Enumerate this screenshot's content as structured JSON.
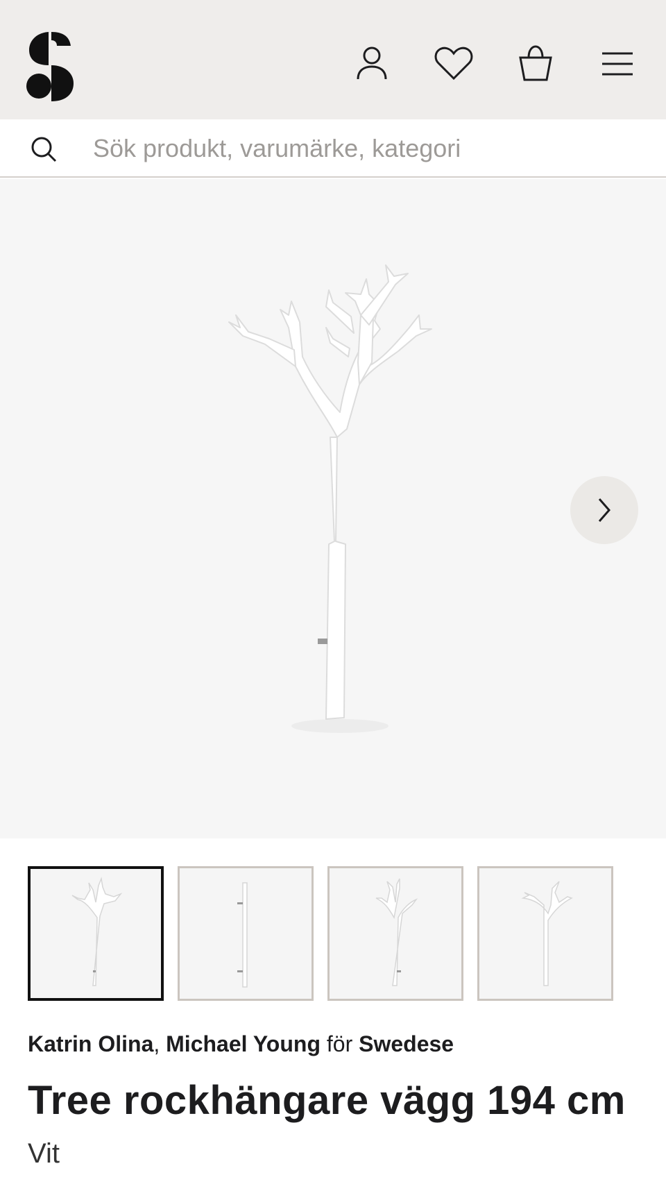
{
  "header": {
    "logo_alt": "S",
    "icons": [
      "account-icon",
      "heart-icon",
      "basket-icon",
      "menu-icon"
    ]
  },
  "search": {
    "placeholder": "Sök produkt, varumärke, kategori"
  },
  "gallery": {
    "thumbnail_count": 4,
    "active_index": 0
  },
  "product": {
    "designer_1": "Katrin Olina",
    "separator": ",",
    "designer_2": "Michael Young",
    "for_word": "för",
    "brand": "Swedese",
    "title": "Tree rockhängare vägg 194 cm",
    "variant": "Vit"
  },
  "colors": {
    "header_bg": "#efedeb",
    "hero_bg": "#f6f6f6",
    "thumb_border": "#cbc5bf",
    "active_border": "#111111"
  }
}
